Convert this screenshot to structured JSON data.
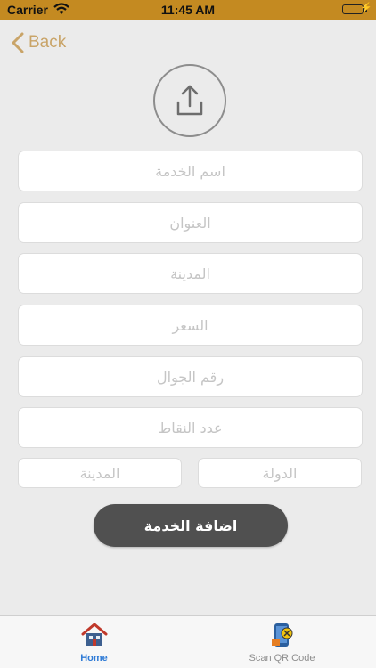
{
  "status_bar": {
    "carrier": "Carrier",
    "time": "11:45 AM",
    "battery_level": 1.0
  },
  "nav": {
    "back_label": "Back"
  },
  "form": {
    "fields": [
      {
        "placeholder": "اسم الخدمة"
      },
      {
        "placeholder": "العنوان"
      },
      {
        "placeholder": "المدينة"
      },
      {
        "placeholder": "السعر"
      },
      {
        "placeholder": "رقم الجوال"
      },
      {
        "placeholder": "عدد النقاط"
      }
    ],
    "country_placeholder": "الدولة",
    "city_placeholder": "المدينة",
    "submit_label": "اضافة الخدمة"
  },
  "tabs": [
    {
      "label": "Home",
      "icon": "home-icon",
      "active": true
    },
    {
      "label": "Scan QR Code",
      "icon": "qr-scan-icon",
      "active": false
    }
  ],
  "colors": {
    "status_bar": "#c48a21",
    "accent": "#c9a468",
    "active_tab": "#2f7bd6",
    "button": "#505050",
    "background": "#ebebeb"
  }
}
